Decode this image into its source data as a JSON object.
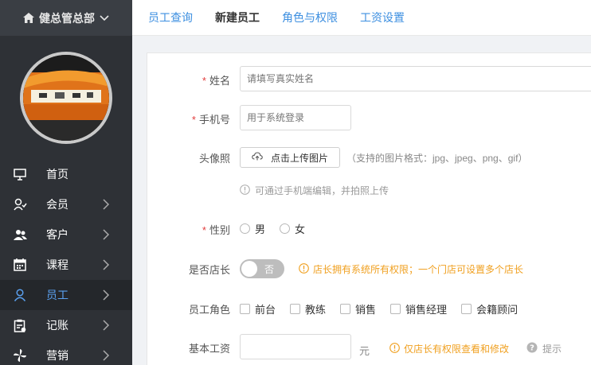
{
  "sidebar": {
    "store_name": "健总管总部",
    "items": [
      {
        "label": "首页",
        "icon": "monitor-icon",
        "chevron": false,
        "active": false
      },
      {
        "label": "会员",
        "icon": "user-check-icon",
        "chevron": true,
        "active": false
      },
      {
        "label": "客户",
        "icon": "users-icon",
        "chevron": true,
        "active": false
      },
      {
        "label": "课程",
        "icon": "calendar-icon",
        "chevron": true,
        "active": false
      },
      {
        "label": "员工",
        "icon": "user-icon",
        "chevron": true,
        "active": true
      },
      {
        "label": "记账",
        "icon": "clipboard-icon",
        "chevron": true,
        "active": false
      },
      {
        "label": "营销",
        "icon": "pinwheel-icon",
        "chevron": true,
        "active": false
      }
    ]
  },
  "tabs": [
    {
      "label": "员工查询",
      "active": false
    },
    {
      "label": "新建员工",
      "active": true
    },
    {
      "label": "角色与权限",
      "active": false
    },
    {
      "label": "工资设置",
      "active": false
    }
  ],
  "form": {
    "name": {
      "label": "姓名",
      "required": true,
      "placeholder": "请填写真实姓名"
    },
    "phone": {
      "label": "手机号",
      "required": true,
      "placeholder": "用于系统登录"
    },
    "avatar": {
      "label": "头像照",
      "upload_label": "点击上传图片",
      "format_hint": "（支持的图片格式：jpg、jpeg、png、gif）",
      "mobile_hint": "可通过手机端编辑，并拍照上传"
    },
    "gender": {
      "label": "性别",
      "required": true,
      "options": [
        "男",
        "女"
      ]
    },
    "manager": {
      "label": "是否店长",
      "toggle_text": "否",
      "toggle_on": false,
      "warning": "店长拥有系统所有权限；一个门店可设置多个店长"
    },
    "role": {
      "label": "员工角色",
      "options": [
        "前台",
        "教练",
        "销售",
        "销售经理",
        "会籍顾问"
      ]
    },
    "salary": {
      "label": "基本工资",
      "unit": "元",
      "warning": "仅店长有权限查看和修改",
      "help": "提示"
    }
  },
  "colors": {
    "sidebar_bg": "#2e3136",
    "accent": "#3d8fe0",
    "required": "#e23d3d",
    "warning": "#f0a020"
  }
}
